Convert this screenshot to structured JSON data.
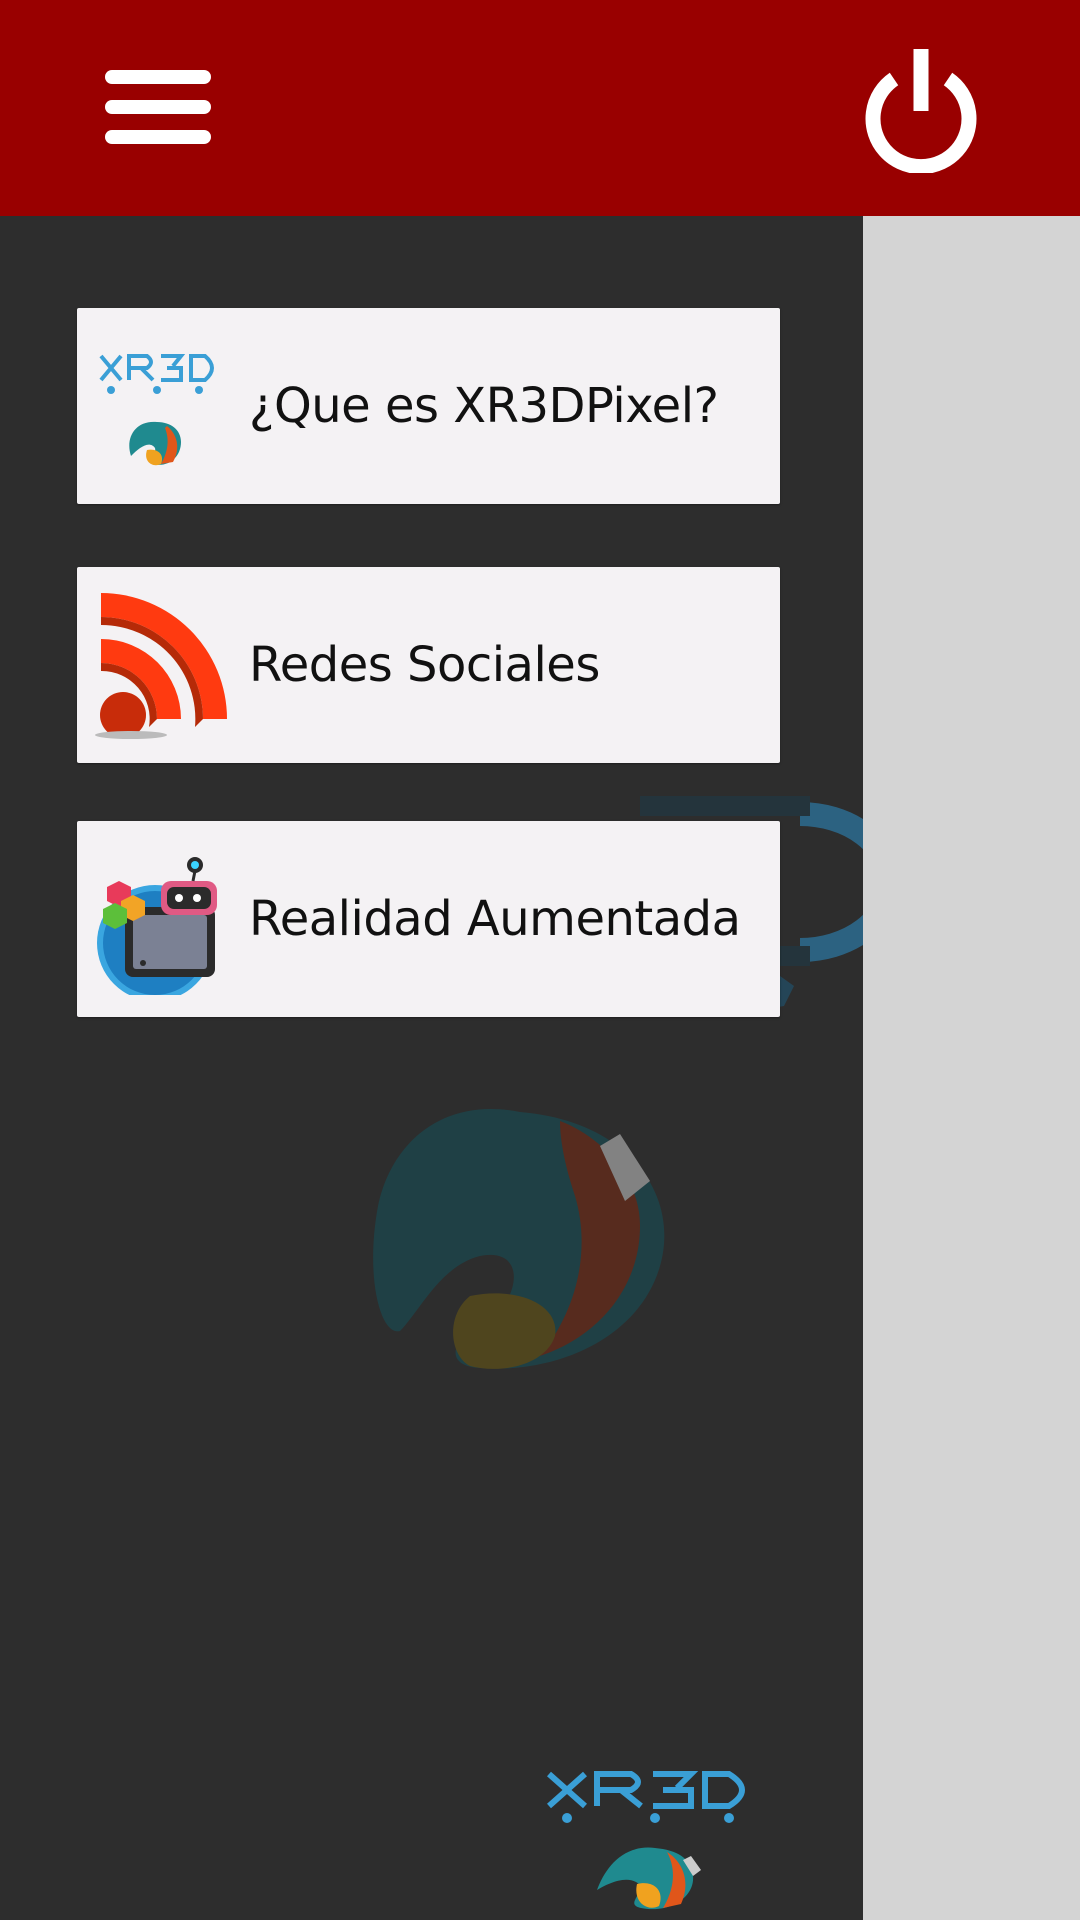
{
  "header": {
    "background": "#990000",
    "menu_icon": "hamburger-menu-icon",
    "power_icon": "power-icon"
  },
  "drawer": {
    "background": "#2d2d2d",
    "items": [
      {
        "label": "¿Que es XR3DPixel?",
        "icon": "xr3d-logo-icon"
      },
      {
        "label": "Redes Sociales",
        "icon": "rss-feed-icon"
      },
      {
        "label": "Realidad Aumentada",
        "icon": "augmented-reality-icon"
      }
    ],
    "footer_logo_text": "XR3D"
  },
  "background_logo_text": "XR3D"
}
